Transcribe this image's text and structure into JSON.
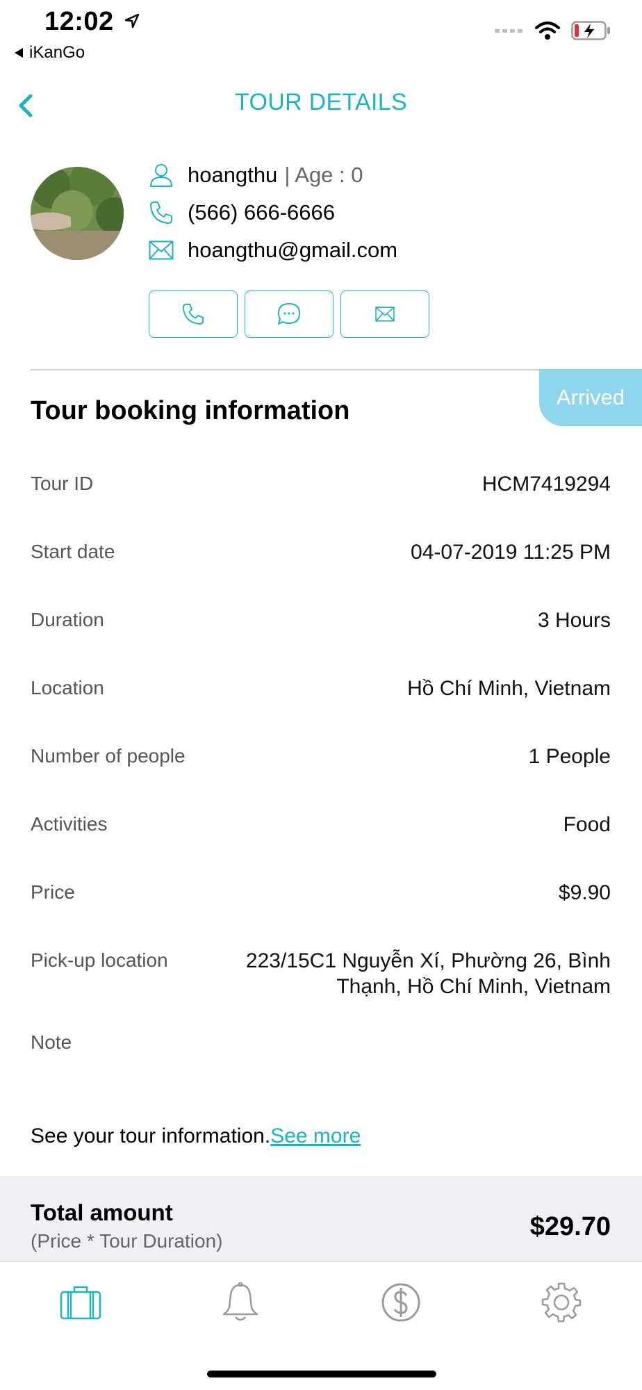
{
  "status_bar": {
    "time": "12:02",
    "back_app": "iKanGo"
  },
  "header": {
    "title": "TOUR DETAILS"
  },
  "profile": {
    "username": "hoangthu",
    "age_text": "| Age : 0",
    "phone": "(566) 666-6666",
    "email": "hoangthu@gmail.com"
  },
  "booking": {
    "status_badge": "Arrived",
    "section_title": "Tour booking information",
    "rows": [
      {
        "label": "Tour ID",
        "value": "HCM7419294"
      },
      {
        "label": "Start date",
        "value": "04-07-2019 11:25 PM"
      },
      {
        "label": "Duration",
        "value": "3 Hours"
      },
      {
        "label": "Location",
        "value": "Hồ Chí Minh, Vietnam"
      },
      {
        "label": "Number of people",
        "value": "1 People"
      },
      {
        "label": "Activities",
        "value": "Food"
      },
      {
        "label": "Price",
        "value": "$9.90"
      },
      {
        "label": "Pick-up location",
        "value_line1": "223/15C1 Nguyễn Xí, Phường 26, Bình",
        "value_line2": "Thạnh, Hồ Chí Minh, Vietnam"
      },
      {
        "label": "Note",
        "value": ""
      }
    ],
    "info_text": "See your tour information.",
    "see_more": "See more"
  },
  "total": {
    "title": "Total amount",
    "subtitle": "(Price * Tour Duration)",
    "amount": "$29.70"
  },
  "tabbar": {
    "tabs": [
      "suitcase-icon",
      "bell-icon",
      "dollar-icon",
      "gear-icon"
    ],
    "active": "suitcase-icon"
  },
  "colors": {
    "accent": "#1eb3c0",
    "badge": "#8dd6ee",
    "inactive": "#9a9a9a"
  }
}
